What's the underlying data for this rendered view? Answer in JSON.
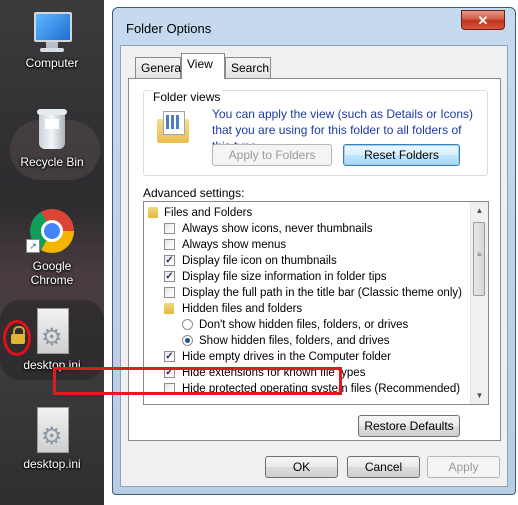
{
  "desktop": {
    "icons": [
      {
        "name": "computer",
        "label": "Computer"
      },
      {
        "name": "recycle-bin",
        "label": "Recycle Bin"
      },
      {
        "name": "google-chrome",
        "label": "Google Chrome"
      },
      {
        "name": "desktop-ini-locked",
        "label": "desktop.ini"
      },
      {
        "name": "desktop-ini",
        "label": "desktop.ini"
      }
    ]
  },
  "dialog": {
    "title": "Folder Options",
    "close_label": "✕",
    "tabs": [
      {
        "label": "General",
        "active": false
      },
      {
        "label": "View",
        "active": true
      },
      {
        "label": "Search",
        "active": false
      }
    ],
    "folder_views": {
      "title": "Folder views",
      "description": "You can apply the view (such as Details or Icons) that you are using for this folder to all folders of this type.",
      "apply_button": "Apply to Folders",
      "reset_button": "Reset Folders"
    },
    "advanced_label": "Advanced settings:",
    "advanced_items": [
      {
        "type": "folder",
        "label": "Files and Folders"
      },
      {
        "type": "checkbox",
        "checked": false,
        "label": "Always show icons, never thumbnails"
      },
      {
        "type": "checkbox",
        "checked": false,
        "label": "Always show menus"
      },
      {
        "type": "checkbox",
        "checked": true,
        "label": "Display file icon on thumbnails"
      },
      {
        "type": "checkbox",
        "checked": true,
        "label": "Display file size information in folder tips"
      },
      {
        "type": "checkbox",
        "checked": false,
        "label": "Display the full path in the title bar (Classic theme only)"
      },
      {
        "type": "folder",
        "label": "Hidden files and folders"
      },
      {
        "type": "radio",
        "checked": false,
        "label": "Don't show hidden files, folders, or drives"
      },
      {
        "type": "radio",
        "checked": true,
        "label": "Show hidden files, folders, and drives"
      },
      {
        "type": "checkbox",
        "checked": true,
        "label": "Hide empty drives in the Computer folder"
      },
      {
        "type": "checkbox",
        "checked": true,
        "label": "Hide extensions for known file types"
      },
      {
        "type": "checkbox",
        "checked": false,
        "label": "Hide protected operating system files (Recommended)"
      }
    ],
    "restore_button": "Restore Defaults",
    "ok_button": "OK",
    "cancel_button": "Cancel",
    "apply_button": "Apply",
    "check_glyph": "✓"
  },
  "colors": {
    "highlight": "#e01a22",
    "link_text": "#1c3b9e"
  }
}
